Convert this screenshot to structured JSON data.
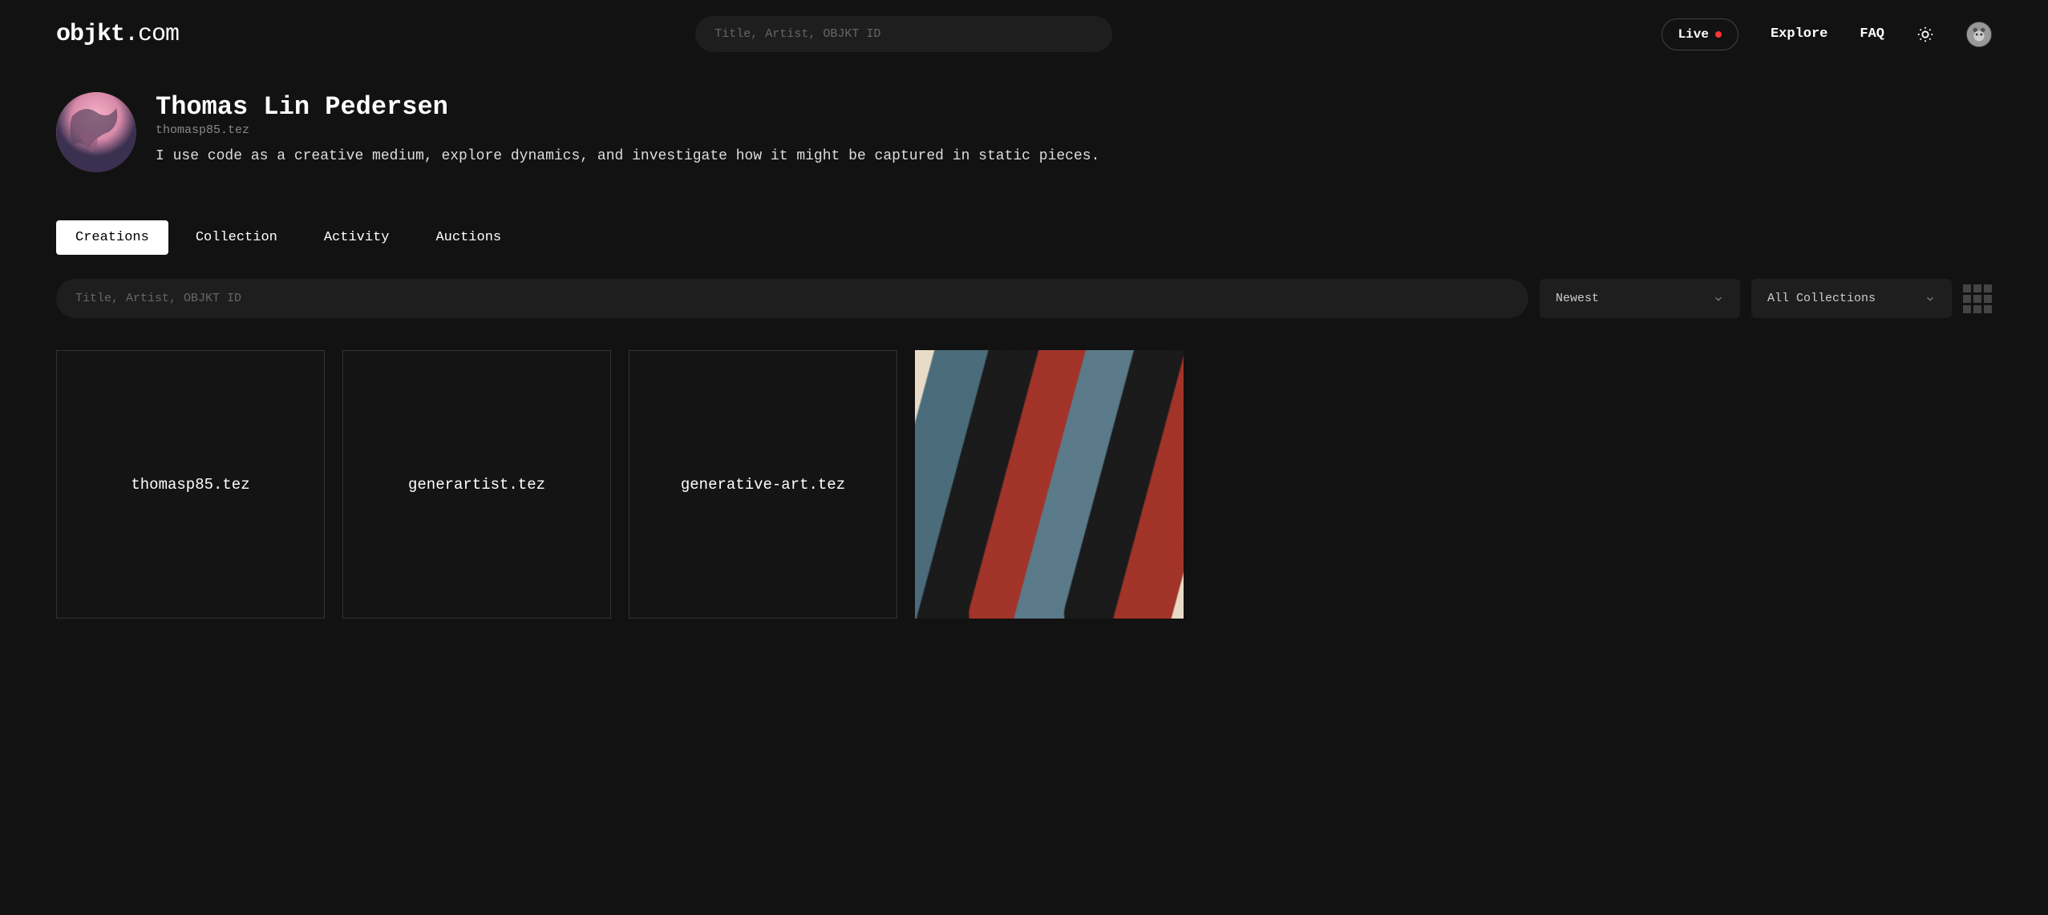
{
  "logo": {
    "main": "objkt",
    "suffix": ".com"
  },
  "header": {
    "search_placeholder": "Title, Artist, OBJKT ID",
    "live_label": "Live",
    "explore_label": "Explore",
    "faq_label": "FAQ"
  },
  "profile": {
    "name": "Thomas Lin Pedersen",
    "handle": "thomasp85.tez",
    "bio": "I use code as a creative medium, explore dynamics, and investigate how it might be captured in static pieces."
  },
  "tabs": [
    {
      "label": "Creations",
      "active": true
    },
    {
      "label": "Collection",
      "active": false
    },
    {
      "label": "Activity",
      "active": false
    },
    {
      "label": "Auctions",
      "active": false
    }
  ],
  "filters": {
    "search_placeholder": "Title, Artist, OBJKT ID",
    "sort_label": "Newest",
    "collection_label": "All Collections"
  },
  "cards": [
    {
      "label": "thomasp85.tez"
    },
    {
      "label": "generartist.tez"
    },
    {
      "label": "generative-art.tez"
    }
  ]
}
